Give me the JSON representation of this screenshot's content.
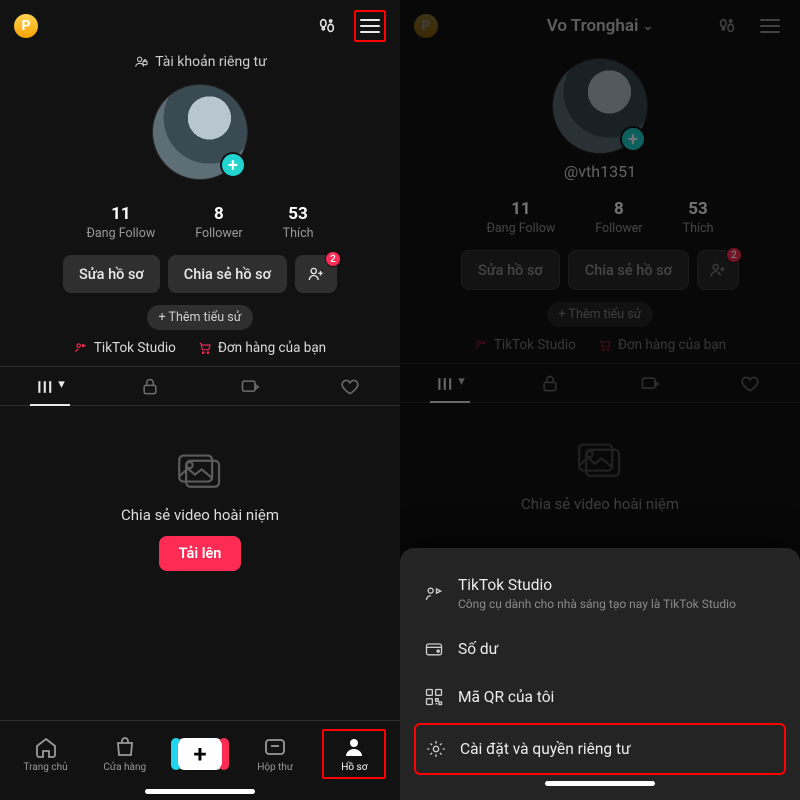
{
  "left": {
    "privacy_text": "Tài khoản riêng tư",
    "stats": {
      "following": {
        "num": "11",
        "label": "Đang Follow"
      },
      "followers": {
        "num": "8",
        "label": "Follower"
      },
      "likes": {
        "num": "53",
        "label": "Thích"
      }
    },
    "edit_btn": "Sửa hồ sơ",
    "share_btn": "Chia sẻ hồ sơ",
    "add_user_badge": "2",
    "add_bio": "+ Thêm tiểu sử",
    "tiktok_studio": "TikTok Studio",
    "orders": "Đơn hàng của bạn",
    "empty_title": "Chia sẻ video hoài niệm",
    "upload_btn": "Tải lên",
    "nav": {
      "home": "Trang chủ",
      "shop": "Cửa hàng",
      "inbox": "Hộp thư",
      "profile": "Hồ sơ"
    }
  },
  "right": {
    "title": "Vo Tronghai",
    "handle": "@vth1351",
    "stats": {
      "following": {
        "num": "11",
        "label": "Đang Follow"
      },
      "followers": {
        "num": "8",
        "label": "Follower"
      },
      "likes": {
        "num": "53",
        "label": "Thích"
      }
    },
    "edit_btn": "Sửa hồ sơ",
    "share_btn": "Chia sẻ hồ sơ",
    "add_user_badge": "2",
    "add_bio": "+ Thêm tiểu sử",
    "tiktok_studio": "TikTok Studio",
    "orders": "Đơn hàng của bạn",
    "empty_title": "Chia sẻ video hoài niệm",
    "sheet": {
      "studio_title": "TikTok Studio",
      "studio_sub": "Công cụ dành cho nhà sáng tạo nay là TikTok Studio",
      "balance": "Số dư",
      "qr": "Mã QR của tôi",
      "settings": "Cài đặt và quyền riêng tư"
    }
  }
}
